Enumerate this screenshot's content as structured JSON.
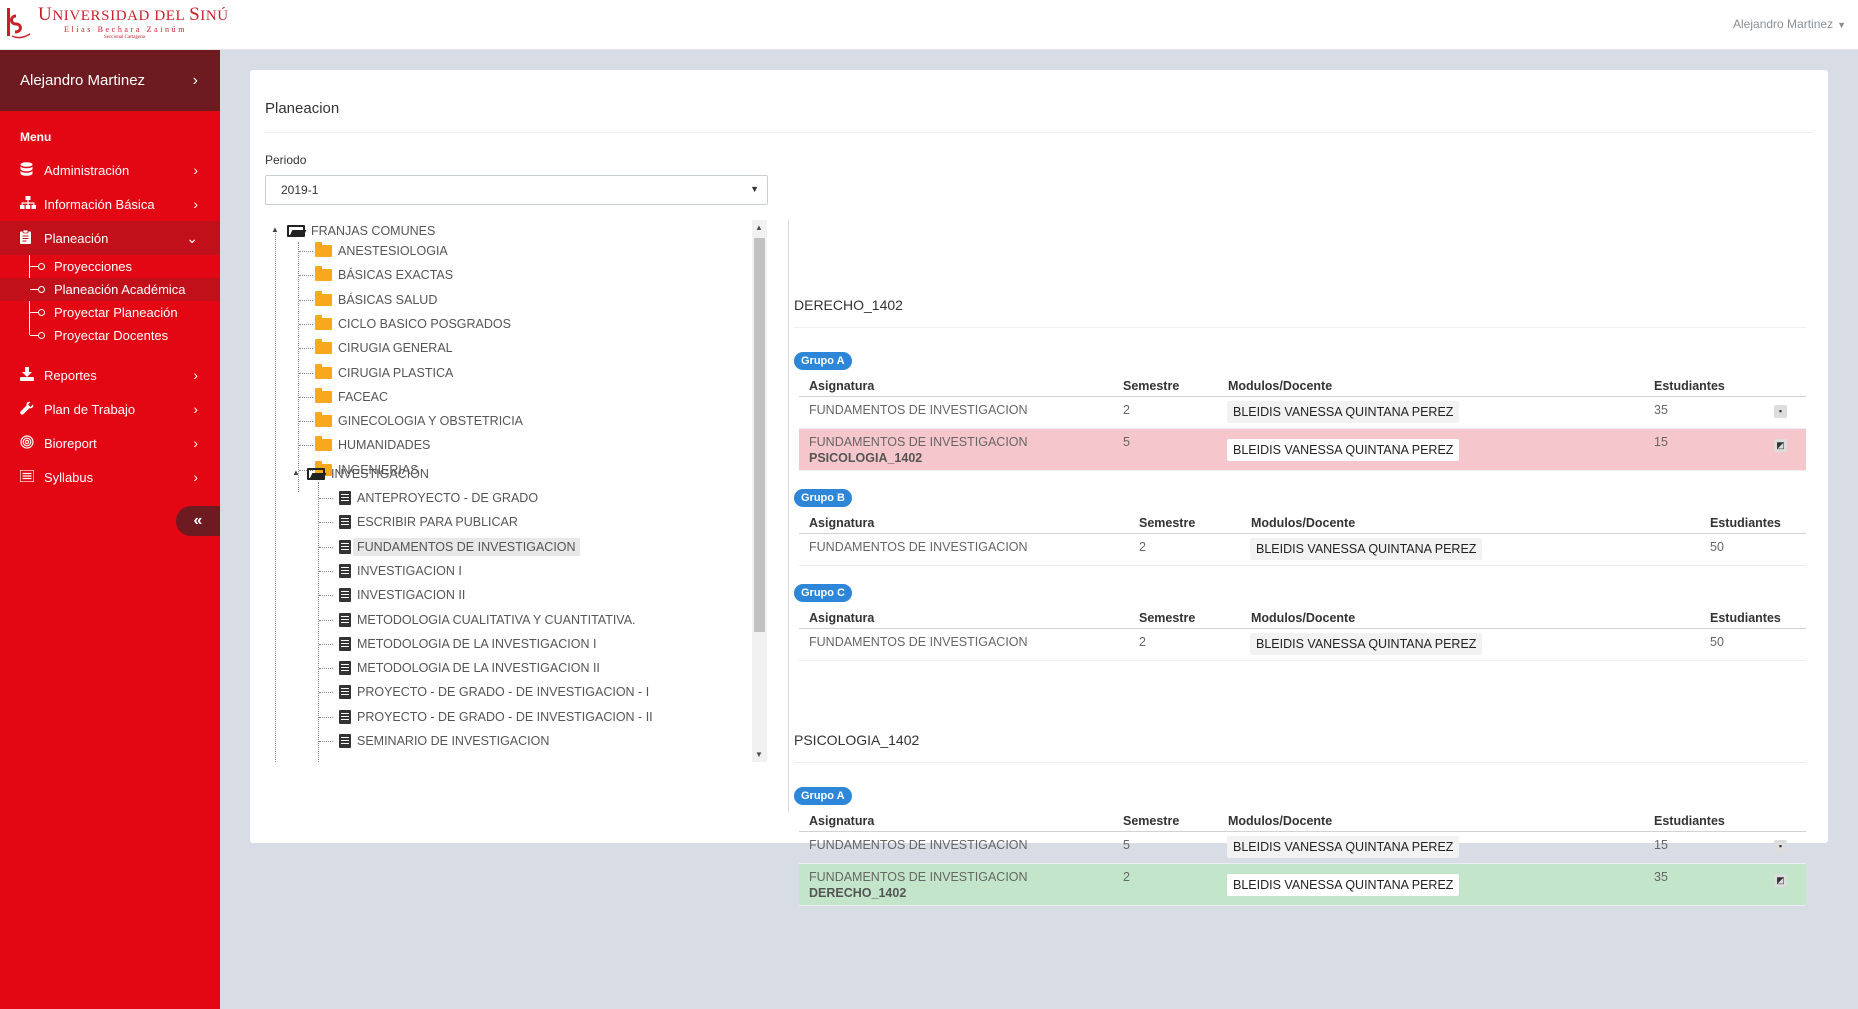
{
  "header": {
    "logo_title_first": "U",
    "logo_title_rest": "NIVERSIDAD DEL ",
    "logo_title_first2": "S",
    "logo_title_rest2": "INÚ",
    "logo_subtitle": "Elías Bechara Zainúm",
    "logo_subtitle2": "Seccional Cartagena",
    "user_name": "Alejandro Martinez"
  },
  "sidebar": {
    "user_name": "Alejandro Martinez",
    "menu_label": "Menu",
    "items": [
      {
        "label": "Administración",
        "icon": "database-icon"
      },
      {
        "label": "Información Básica",
        "icon": "sitemap-icon"
      },
      {
        "label": "Planeación",
        "icon": "clipboard-icon",
        "active": true
      },
      {
        "label": "Reportes",
        "icon": "download-icon"
      },
      {
        "label": "Plan de Trabajo",
        "icon": "wrench-icon"
      },
      {
        "label": "Bioreport",
        "icon": "fingerprint-icon"
      },
      {
        "label": "Syllabus",
        "icon": "list-icon"
      }
    ],
    "sub_items": [
      {
        "label": "Proyecciones"
      },
      {
        "label": "Planeación Académica",
        "active": true
      },
      {
        "label": "Proyectar Planeación"
      },
      {
        "label": "Proyectar Docentes"
      }
    ]
  },
  "page": {
    "title": "Planeacion",
    "periodo_label": "Periodo",
    "periodo_value": "2019-1"
  },
  "tree": {
    "root": "FRANJAS COMUNES",
    "folders": [
      "ANESTESIOLOGIA",
      "BÁSICAS EXACTAS",
      "BÁSICAS SALUD",
      "CICLO BASICO POSGRADOS",
      "CIRUGIA GENERAL",
      "CIRUGIA PLASTICA",
      "FACEAC",
      "GINECOLOGIA Y OBSTETRICIA",
      "HUMANIDADES",
      "INGENIERIAS"
    ],
    "open_folder": "INVESTIGACIÓN",
    "courses": [
      "ANTEPROYECTO - DE GRADO",
      "ESCRIBIR PARA PUBLICAR",
      "FUNDAMENTOS DE INVESTIGACION",
      "INVESTIGACION I",
      "INVESTIGACION II",
      "METODOLOGIA CUALITATIVA Y CUANTITATIVA.",
      "METODOLOGIA DE LA INVESTIGACION I",
      "METODOLOGIA DE LA INVESTIGACION II",
      "PROYECTO - DE GRADO - DE INVESTIGACION - I",
      "PROYECTO - DE GRADO - DE INVESTIGACION - II",
      "SEMINARIO DE INVESTIGACION"
    ],
    "selected_course": "FUNDAMENTOS DE INVESTIGACION"
  },
  "columns": {
    "asignatura": "Asignatura",
    "semestre": "Semestre",
    "docente": "Modulos/Docente",
    "estudiantes": "Estudiantes"
  },
  "sections": [
    {
      "title": "DERECHO_1402",
      "groups": [
        {
          "badge": "Grupo A",
          "rows": [
            {
              "asignatura": "FUNDAMENTOS DE INVESTIGACION",
              "asignatura2": "",
              "semestre": "2",
              "docente": "BLEIDIS VANESSA QUINTANA PEREZ",
              "estudiantes": "35",
              "icon": "trash-icon"
            },
            {
              "asignatura": "FUNDAMENTOS DE INVESTIGACION",
              "asignatura2": "PSICOLOGIA_1402",
              "semestre": "5",
              "docente": "BLEIDIS VANESSA QUINTANA PEREZ",
              "estudiantes": "15",
              "icon": "shared-icon"
            }
          ]
        },
        {
          "badge": "Grupo B",
          "rows": [
            {
              "asignatura": "FUNDAMENTOS DE INVESTIGACION",
              "semestre": "2",
              "docente": "BLEIDIS VANESSA QUINTANA PEREZ",
              "estudiantes": "50"
            }
          ]
        },
        {
          "badge": "Grupo C",
          "rows": [
            {
              "asignatura": "FUNDAMENTOS DE INVESTIGACION",
              "semestre": "2",
              "docente": "BLEIDIS VANESSA QUINTANA PEREZ",
              "estudiantes": "50"
            }
          ]
        }
      ]
    },
    {
      "title": "PSICOLOGIA_1402",
      "groups": [
        {
          "badge": "Grupo A",
          "rows": [
            {
              "asignatura": "FUNDAMENTOS DE INVESTIGACION",
              "asignatura2": "",
              "semestre": "5",
              "docente": "BLEIDIS VANESSA QUINTANA PEREZ",
              "estudiantes": "15",
              "icon": "trash-icon"
            },
            {
              "asignatura": "FUNDAMENTOS DE INVESTIGACION",
              "asignatura2": "DERECHO_1402",
              "semestre": "2",
              "docente": "BLEIDIS VANESSA QUINTANA PEREZ",
              "estudiantes": "35",
              "icon": "shared-icon"
            }
          ]
        }
      ]
    }
  ],
  "colors": {
    "sidebar": "#e30613",
    "sidebar_dark": "#6d1a20",
    "badge": "#2e86d8",
    "row_pink": "#f5c6cb",
    "row_green": "#c3e6cb"
  }
}
